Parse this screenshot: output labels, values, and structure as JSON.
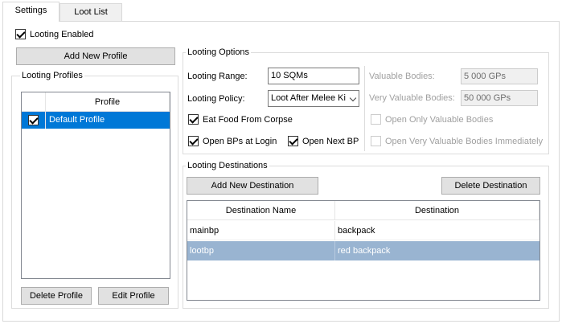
{
  "tabs": [
    "Settings",
    "Loot List"
  ],
  "looting_enabled": {
    "label": "Looting Enabled",
    "checked": true
  },
  "add_profile_label": "Add New Profile",
  "profiles_group": {
    "title": "Looting Profiles",
    "column": "Profile",
    "rows": [
      {
        "name": "Default Profile",
        "checked": true,
        "selected": true
      }
    ],
    "delete_label": "Delete Profile",
    "edit_label": "Edit Profile"
  },
  "options_group": {
    "title": "Looting Options",
    "range_label": "Looting Range:",
    "range_value": "10 SQMs",
    "policy_label": "Looting Policy:",
    "policy_value": "Loot After Melee Ki",
    "eat_food": {
      "label": "Eat Food From Corpse",
      "checked": true
    },
    "open_bps": {
      "label": "Open BPs at Login",
      "checked": true
    },
    "open_next": {
      "label": "Open Next BP",
      "checked": true
    },
    "valuable_label": "Valuable Bodies:",
    "valuable_value": "5 000 GPs",
    "very_valuable_label": "Very Valuable Bodies:",
    "very_valuable_value": "50 000 GPs",
    "only_valuable": {
      "label": "Open Only Valuable Bodies",
      "checked": false
    },
    "very_valuable_immediately": {
      "label": "Open Very Valuable Bodies Immediately",
      "checked": false
    }
  },
  "destinations_group": {
    "title": "Looting Destinations",
    "add_label": "Add New Destination",
    "delete_label": "Delete Destination",
    "columns": [
      "Destination Name",
      "Destination"
    ],
    "rows": [
      {
        "name": "mainbp",
        "destination": "backpack",
        "selected": false
      },
      {
        "name": "lootbp",
        "destination": "red backpack",
        "selected": true
      }
    ]
  },
  "colors": {
    "selection": "#0078d7",
    "selection_inactive": "#99b4d1"
  }
}
